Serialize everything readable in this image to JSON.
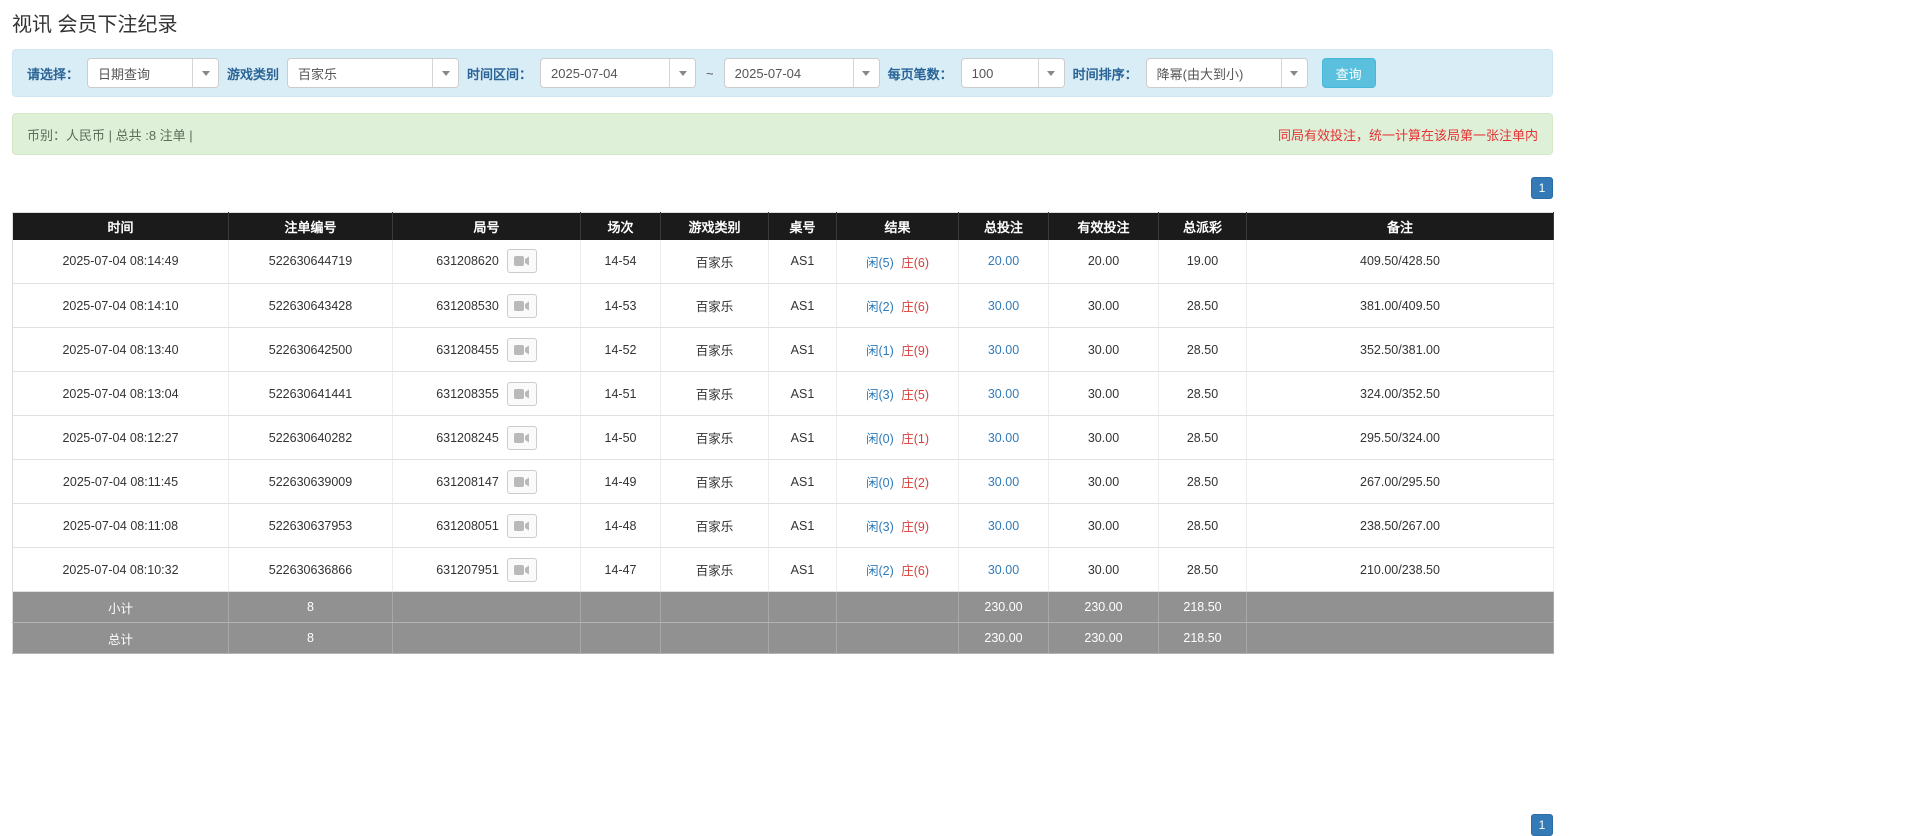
{
  "page": {
    "title": "视讯 会员下注纪录"
  },
  "filters": {
    "select_label": "请选择：",
    "select_value": "日期查询",
    "game_type_label": "游戏类别",
    "game_type_value": "百家乐",
    "time_range_label": "时间区间：",
    "date_from": "2025-07-04",
    "tilde": "~",
    "date_to": "2025-07-04",
    "page_size_label": "每页笔数：",
    "page_size_value": "100",
    "sort_label": "时间排序：",
    "sort_value": "降幂(由大到小)",
    "search_button": "查询"
  },
  "summary": {
    "left": "币别：人民币 | 总共 :8 注单 |",
    "right": "同局有效投注，统一计算在该局第一张注单内"
  },
  "pagination": {
    "page": "1"
  },
  "table": {
    "headers": [
      "时间",
      "注单编号",
      "局号",
      "场次",
      "游戏类别",
      "桌号",
      "结果",
      "总投注",
      "有效投注",
      "总派彩",
      "备注"
    ],
    "rows": [
      {
        "time": "2025-07-04 08:14:49",
        "bet_id": "522630644719",
        "round_id": "631208620",
        "session": "14-54",
        "game": "百家乐",
        "table_no": "AS1",
        "player": "闲(5)",
        "banker": "庄(6)",
        "total_bet": "20.00",
        "valid_bet": "20.00",
        "payout": "19.00",
        "remark": "409.50/428.50"
      },
      {
        "time": "2025-07-04 08:14:10",
        "bet_id": "522630643428",
        "round_id": "631208530",
        "session": "14-53",
        "game": "百家乐",
        "table_no": "AS1",
        "player": "闲(2)",
        "banker": "庄(6)",
        "total_bet": "30.00",
        "valid_bet": "30.00",
        "payout": "28.50",
        "remark": "381.00/409.50"
      },
      {
        "time": "2025-07-04 08:13:40",
        "bet_id": "522630642500",
        "round_id": "631208455",
        "session": "14-52",
        "game": "百家乐",
        "table_no": "AS1",
        "player": "闲(1)",
        "banker": "庄(9)",
        "total_bet": "30.00",
        "valid_bet": "30.00",
        "payout": "28.50",
        "remark": "352.50/381.00"
      },
      {
        "time": "2025-07-04 08:13:04",
        "bet_id": "522630641441",
        "round_id": "631208355",
        "session": "14-51",
        "game": "百家乐",
        "table_no": "AS1",
        "player": "闲(3)",
        "banker": "庄(5)",
        "total_bet": "30.00",
        "valid_bet": "30.00",
        "payout": "28.50",
        "remark": "324.00/352.50"
      },
      {
        "time": "2025-07-04 08:12:27",
        "bet_id": "522630640282",
        "round_id": "631208245",
        "session": "14-50",
        "game": "百家乐",
        "table_no": "AS1",
        "player": "闲(0)",
        "banker": "庄(1)",
        "total_bet": "30.00",
        "valid_bet": "30.00",
        "payout": "28.50",
        "remark": "295.50/324.00"
      },
      {
        "time": "2025-07-04 08:11:45",
        "bet_id": "522630639009",
        "round_id": "631208147",
        "session": "14-49",
        "game": "百家乐",
        "table_no": "AS1",
        "player": "闲(0)",
        "banker": "庄(2)",
        "total_bet": "30.00",
        "valid_bet": "30.00",
        "payout": "28.50",
        "remark": "267.00/295.50"
      },
      {
        "time": "2025-07-04 08:11:08",
        "bet_id": "522630637953",
        "round_id": "631208051",
        "session": "14-48",
        "game": "百家乐",
        "table_no": "AS1",
        "player": "闲(3)",
        "banker": "庄(9)",
        "total_bet": "30.00",
        "valid_bet": "30.00",
        "payout": "28.50",
        "remark": "238.50/267.00"
      },
      {
        "time": "2025-07-04 08:10:32",
        "bet_id": "522630636866",
        "round_id": "631207951",
        "session": "14-47",
        "game": "百家乐",
        "table_no": "AS1",
        "player": "闲(2)",
        "banker": "庄(6)",
        "total_bet": "30.00",
        "valid_bet": "30.00",
        "payout": "28.50",
        "remark": "210.00/238.50"
      }
    ],
    "subtotal": {
      "label": "小计",
      "count": "8",
      "total_bet": "230.00",
      "valid_bet": "230.00",
      "payout": "218.50"
    },
    "total": {
      "label": "总计",
      "count": "8",
      "total_bet": "230.00",
      "valid_bet": "230.00",
      "payout": "218.50"
    }
  }
}
